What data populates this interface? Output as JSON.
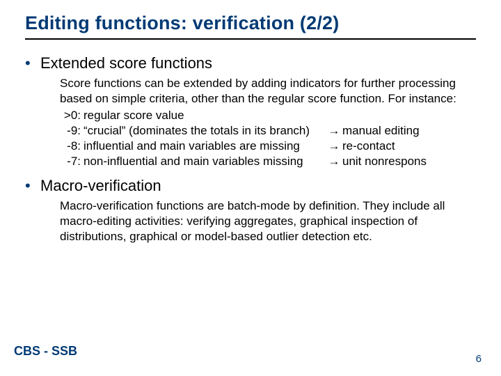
{
  "title": "Editing functions: verification (2/2)",
  "section1": {
    "heading": "Extended score functions",
    "intro": "Score functions can be extended by adding indicators for further processing based on simple criteria, other than the regular score function. For instance:",
    "rows": [
      {
        "code": ">0:",
        "desc": "regular score value",
        "arrow": "",
        "action": ""
      },
      {
        "code": "-9:",
        "desc": "“crucial” (dominates the totals in its branch)",
        "arrow": "→",
        "action": "manual editing"
      },
      {
        "code": "-8:",
        "desc": "influential and main variables are missing",
        "arrow": "→",
        "action": "re-contact"
      },
      {
        "code": "-7:",
        "desc": "non-influential and main variables missing",
        "arrow": "→",
        "action": "unit nonrespons"
      }
    ]
  },
  "section2": {
    "heading": "Macro-verification",
    "body": "Macro-verification functions are batch-mode by definition. They include all macro-editing activities: verifying aggregates, graphical inspection of distributions, graphical or model-based outlier detection etc."
  },
  "footer": {
    "label": "CBS - SSB",
    "page": "6"
  }
}
